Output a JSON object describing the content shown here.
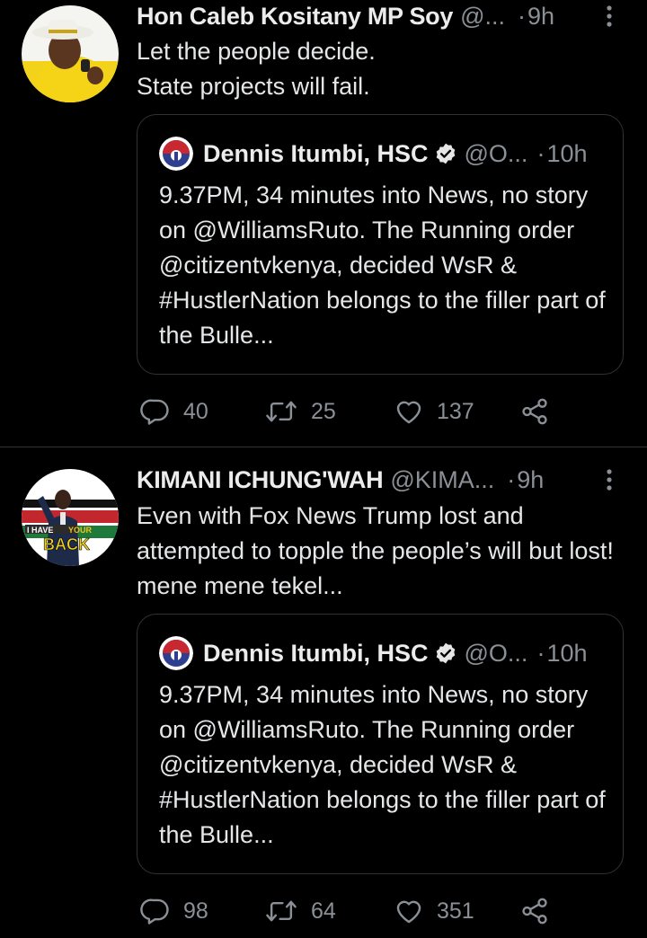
{
  "tweets": [
    {
      "name": "Hon Caleb Kositany MP Soy",
      "handle": "@...",
      "dot": "·",
      "time": "9h",
      "text": "Let the people decide.\nState projects will fail.",
      "quote": {
        "name": "Dennis Itumbi, HSC",
        "handle": "@O...",
        "dot": "·",
        "time": "10h",
        "text": "9.37PM, 34 minutes into News, no story on @WilliamsRuto. The Running order @citizentvkenya, decided WsR & #HustlerNation belongs to the filler part of the Bulle..."
      },
      "actions": {
        "replies": "40",
        "retweets": "25",
        "likes": "137"
      }
    },
    {
      "name": "KIMANI ICHUNG'WAH",
      "handle": "@KIMA...",
      "dot": "·",
      "time": "9h",
      "text": "Even with Fox News Trump lost and attempted to topple the people’s will but lost! mene mene tekel...",
      "avatar_banner": "I HAVE YOUR BACK",
      "quote": {
        "name": "Dennis Itumbi, HSC",
        "handle": "@O...",
        "dot": "·",
        "time": "10h",
        "text": "9.37PM, 34 minutes into News, no story on @WilliamsRuto. The Running order @citizentvkenya, decided WsR & #HustlerNation belongs to the filler part of the Bulle..."
      },
      "actions": {
        "replies": "98",
        "retweets": "64",
        "likes": "351"
      }
    }
  ],
  "icons": {
    "more": "more-vertical-icon",
    "verified": "verified-badge-icon",
    "reply": "reply-icon",
    "retweet": "retweet-icon",
    "like": "heart-icon",
    "share": "share-icon"
  },
  "colors": {
    "background": "#000000",
    "text": "#e4e6e8",
    "secondary": "#8b9096",
    "border": "#2f3336"
  }
}
